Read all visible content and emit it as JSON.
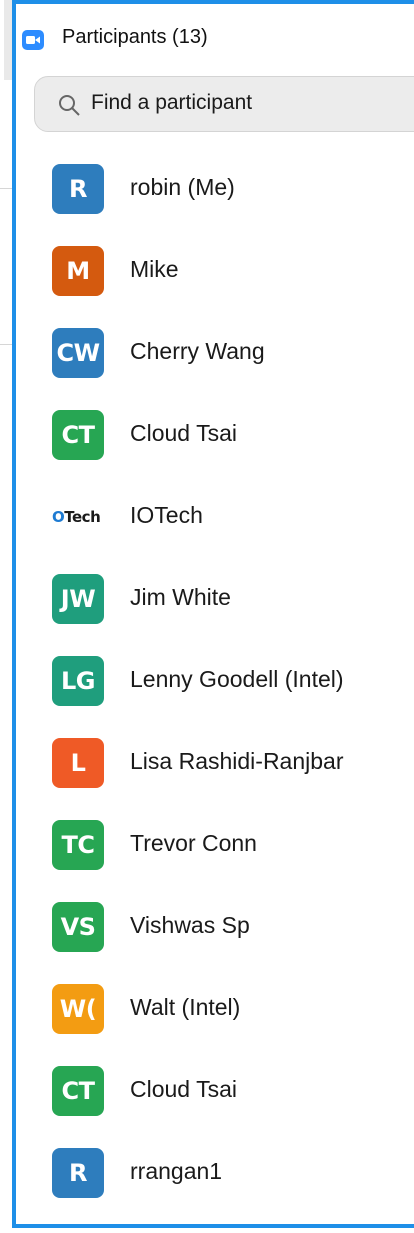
{
  "panel": {
    "title": "Participants (13)",
    "accent_color": "#1e8fe8",
    "app_icon": "video-camera-icon"
  },
  "search": {
    "placeholder": "Find a participant",
    "icon": "search-icon"
  },
  "participants": [
    {
      "initials": "R",
      "name": "robin (Me)",
      "color": "#2e7dbd"
    },
    {
      "initials": "M",
      "name": "Mike",
      "color": "#d45a0f"
    },
    {
      "initials": "CW",
      "name": "Cherry Wang",
      "color": "#2e7dbd"
    },
    {
      "initials": "CT",
      "name": "Cloud Tsai",
      "color": "#27a653"
    },
    {
      "initials": "OTech",
      "name": "IOTech",
      "color": "logo"
    },
    {
      "initials": "JW",
      "name": "Jim White",
      "color": "#1f9e7d"
    },
    {
      "initials": "LG",
      "name": "Lenny Goodell (Intel)",
      "color": "#1f9e7d"
    },
    {
      "initials": "L",
      "name": "Lisa Rashidi-Ranjbar",
      "color": "#ef5a26"
    },
    {
      "initials": "TC",
      "name": "Trevor Conn",
      "color": "#27a653"
    },
    {
      "initials": "VS",
      "name": "Vishwas Sp",
      "color": "#27a653"
    },
    {
      "initials": "W(",
      "name": "Walt (Intel)",
      "color": "#f39c12"
    },
    {
      "initials": "CT",
      "name": "Cloud Tsai",
      "color": "#27a653"
    },
    {
      "initials": "R",
      "name": "rrangan1",
      "color": "#2e7dbd"
    }
  ]
}
